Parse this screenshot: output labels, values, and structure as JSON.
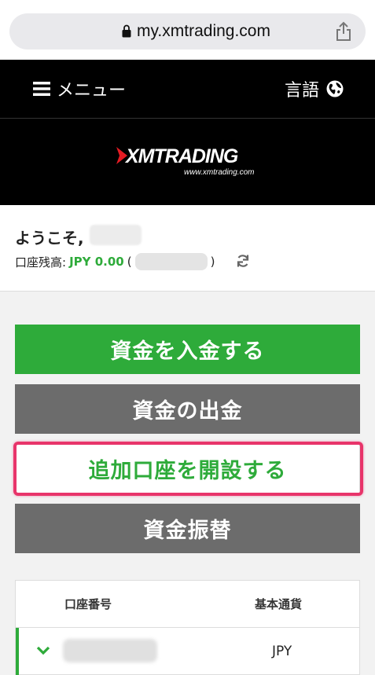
{
  "browser": {
    "url": "my.xmtrading.com"
  },
  "header": {
    "menu_label": "メニュー",
    "language_label": "言語"
  },
  "logo": {
    "main": "XMTRADING",
    "sub": "www.xmtrading.com"
  },
  "welcome": {
    "greeting": "ようこそ,",
    "balance_label": "口座残高:",
    "balance_value": "JPY 0.00",
    "paren_open": "(",
    "paren_close": ")"
  },
  "actions": {
    "deposit": "資金を入金する",
    "withdraw": "資金の出金",
    "open_account": "追加口座を開設する",
    "transfer": "資金振替"
  },
  "accounts_table": {
    "columns": [
      "口座番号",
      "基本通貨"
    ],
    "rows": [
      {
        "currency": "JPY"
      }
    ]
  },
  "colors": {
    "brand_green": "#2eab3a",
    "highlight_pink": "#e8346a",
    "dark_button": "#6c6c6c"
  },
  "icons": [
    "lock-icon",
    "share-icon",
    "hamburger-icon",
    "globe-icon",
    "refresh-icon",
    "chevron-down-icon"
  ]
}
